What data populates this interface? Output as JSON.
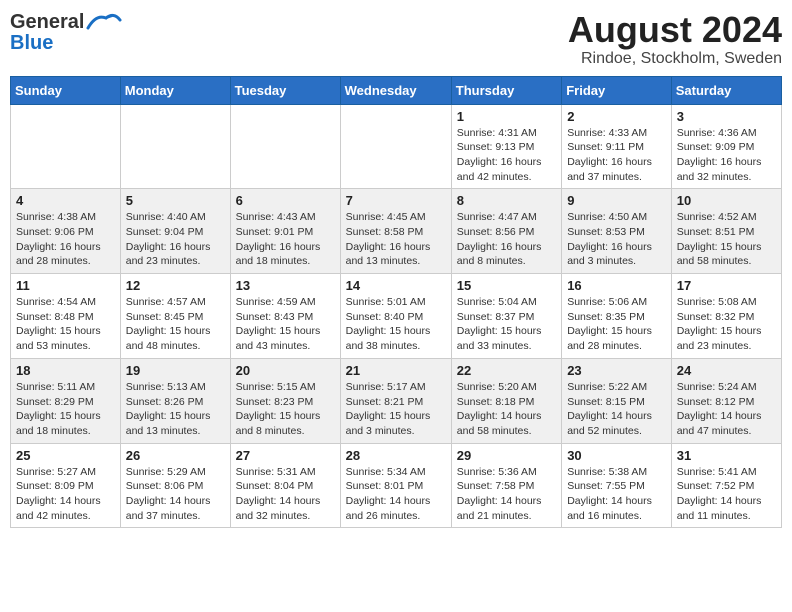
{
  "header": {
    "logo_general": "General",
    "logo_blue": "Blue",
    "main_title": "August 2024",
    "subtitle": "Rindoe, Stockholm, Sweden"
  },
  "calendar": {
    "days_of_week": [
      "Sunday",
      "Monday",
      "Tuesday",
      "Wednesday",
      "Thursday",
      "Friday",
      "Saturday"
    ],
    "weeks": [
      [
        {
          "day": "",
          "info": ""
        },
        {
          "day": "",
          "info": ""
        },
        {
          "day": "",
          "info": ""
        },
        {
          "day": "",
          "info": ""
        },
        {
          "day": "1",
          "info": "Sunrise: 4:31 AM\nSunset: 9:13 PM\nDaylight: 16 hours\nand 42 minutes."
        },
        {
          "day": "2",
          "info": "Sunrise: 4:33 AM\nSunset: 9:11 PM\nDaylight: 16 hours\nand 37 minutes."
        },
        {
          "day": "3",
          "info": "Sunrise: 4:36 AM\nSunset: 9:09 PM\nDaylight: 16 hours\nand 32 minutes."
        }
      ],
      [
        {
          "day": "4",
          "info": "Sunrise: 4:38 AM\nSunset: 9:06 PM\nDaylight: 16 hours\nand 28 minutes."
        },
        {
          "day": "5",
          "info": "Sunrise: 4:40 AM\nSunset: 9:04 PM\nDaylight: 16 hours\nand 23 minutes."
        },
        {
          "day": "6",
          "info": "Sunrise: 4:43 AM\nSunset: 9:01 PM\nDaylight: 16 hours\nand 18 minutes."
        },
        {
          "day": "7",
          "info": "Sunrise: 4:45 AM\nSunset: 8:58 PM\nDaylight: 16 hours\nand 13 minutes."
        },
        {
          "day": "8",
          "info": "Sunrise: 4:47 AM\nSunset: 8:56 PM\nDaylight: 16 hours\nand 8 minutes."
        },
        {
          "day": "9",
          "info": "Sunrise: 4:50 AM\nSunset: 8:53 PM\nDaylight: 16 hours\nand 3 minutes."
        },
        {
          "day": "10",
          "info": "Sunrise: 4:52 AM\nSunset: 8:51 PM\nDaylight: 15 hours\nand 58 minutes."
        }
      ],
      [
        {
          "day": "11",
          "info": "Sunrise: 4:54 AM\nSunset: 8:48 PM\nDaylight: 15 hours\nand 53 minutes."
        },
        {
          "day": "12",
          "info": "Sunrise: 4:57 AM\nSunset: 8:45 PM\nDaylight: 15 hours\nand 48 minutes."
        },
        {
          "day": "13",
          "info": "Sunrise: 4:59 AM\nSunset: 8:43 PM\nDaylight: 15 hours\nand 43 minutes."
        },
        {
          "day": "14",
          "info": "Sunrise: 5:01 AM\nSunset: 8:40 PM\nDaylight: 15 hours\nand 38 minutes."
        },
        {
          "day": "15",
          "info": "Sunrise: 5:04 AM\nSunset: 8:37 PM\nDaylight: 15 hours\nand 33 minutes."
        },
        {
          "day": "16",
          "info": "Sunrise: 5:06 AM\nSunset: 8:35 PM\nDaylight: 15 hours\nand 28 minutes."
        },
        {
          "day": "17",
          "info": "Sunrise: 5:08 AM\nSunset: 8:32 PM\nDaylight: 15 hours\nand 23 minutes."
        }
      ],
      [
        {
          "day": "18",
          "info": "Sunrise: 5:11 AM\nSunset: 8:29 PM\nDaylight: 15 hours\nand 18 minutes."
        },
        {
          "day": "19",
          "info": "Sunrise: 5:13 AM\nSunset: 8:26 PM\nDaylight: 15 hours\nand 13 minutes."
        },
        {
          "day": "20",
          "info": "Sunrise: 5:15 AM\nSunset: 8:23 PM\nDaylight: 15 hours\nand 8 minutes."
        },
        {
          "day": "21",
          "info": "Sunrise: 5:17 AM\nSunset: 8:21 PM\nDaylight: 15 hours\nand 3 minutes."
        },
        {
          "day": "22",
          "info": "Sunrise: 5:20 AM\nSunset: 8:18 PM\nDaylight: 14 hours\nand 58 minutes."
        },
        {
          "day": "23",
          "info": "Sunrise: 5:22 AM\nSunset: 8:15 PM\nDaylight: 14 hours\nand 52 minutes."
        },
        {
          "day": "24",
          "info": "Sunrise: 5:24 AM\nSunset: 8:12 PM\nDaylight: 14 hours\nand 47 minutes."
        }
      ],
      [
        {
          "day": "25",
          "info": "Sunrise: 5:27 AM\nSunset: 8:09 PM\nDaylight: 14 hours\nand 42 minutes."
        },
        {
          "day": "26",
          "info": "Sunrise: 5:29 AM\nSunset: 8:06 PM\nDaylight: 14 hours\nand 37 minutes."
        },
        {
          "day": "27",
          "info": "Sunrise: 5:31 AM\nSunset: 8:04 PM\nDaylight: 14 hours\nand 32 minutes."
        },
        {
          "day": "28",
          "info": "Sunrise: 5:34 AM\nSunset: 8:01 PM\nDaylight: 14 hours\nand 26 minutes."
        },
        {
          "day": "29",
          "info": "Sunrise: 5:36 AM\nSunset: 7:58 PM\nDaylight: 14 hours\nand 21 minutes."
        },
        {
          "day": "30",
          "info": "Sunrise: 5:38 AM\nSunset: 7:55 PM\nDaylight: 14 hours\nand 16 minutes."
        },
        {
          "day": "31",
          "info": "Sunrise: 5:41 AM\nSunset: 7:52 PM\nDaylight: 14 hours\nand 11 minutes."
        }
      ]
    ]
  }
}
